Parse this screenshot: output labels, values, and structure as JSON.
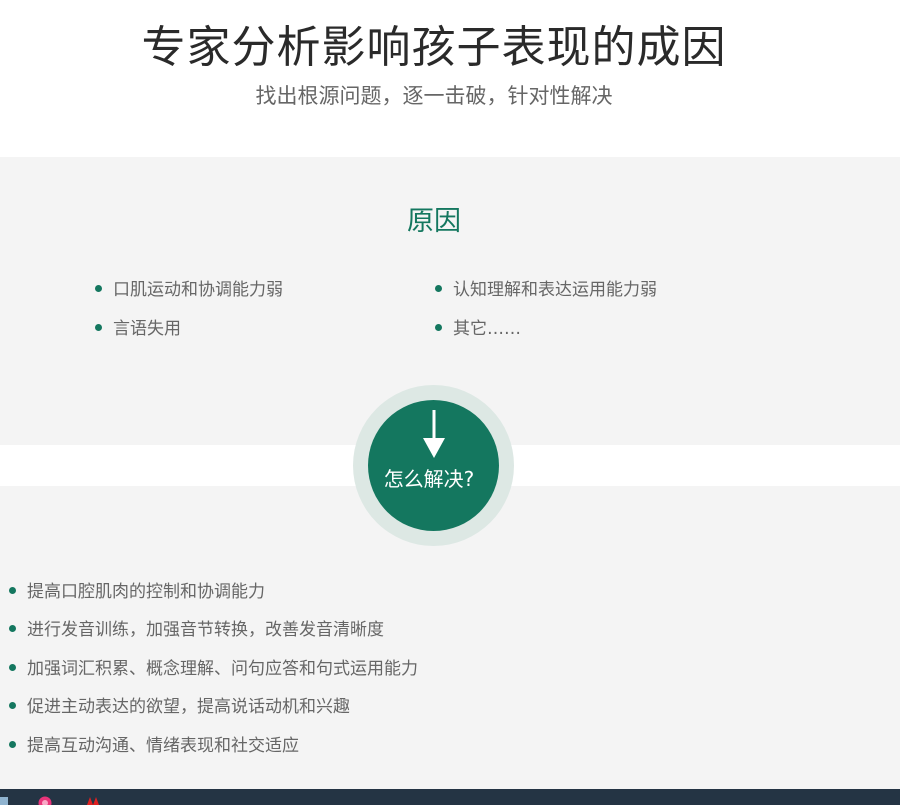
{
  "header": {
    "title": "专家分析影响孩子表现的成因",
    "subtitle": "找出根源问题，逐一击破，针对性解决"
  },
  "causes": {
    "title": "原因",
    "items": [
      "口肌运动和协调能力弱",
      "认知理解和表达运用能力弱",
      "言语失用",
      "其它……"
    ]
  },
  "solve": {
    "label": "怎么解决?",
    "icon": "arrow-down-icon"
  },
  "solutions": {
    "items": [
      "提高口腔肌肉的控制和协调能力",
      "进行发音训练，加强音节转换，改善发音清晰度",
      "加强词汇积累、概念理解、问句应答和句式运用能力",
      "促进主动表达的欲望，提高说话动机和兴趣",
      "提高互动沟通、情绪表现和社交适应"
    ]
  },
  "theme": {
    "accent": "#14775f",
    "panel_bg": "#f4f4f4",
    "taskbar_bg": "#243444"
  }
}
